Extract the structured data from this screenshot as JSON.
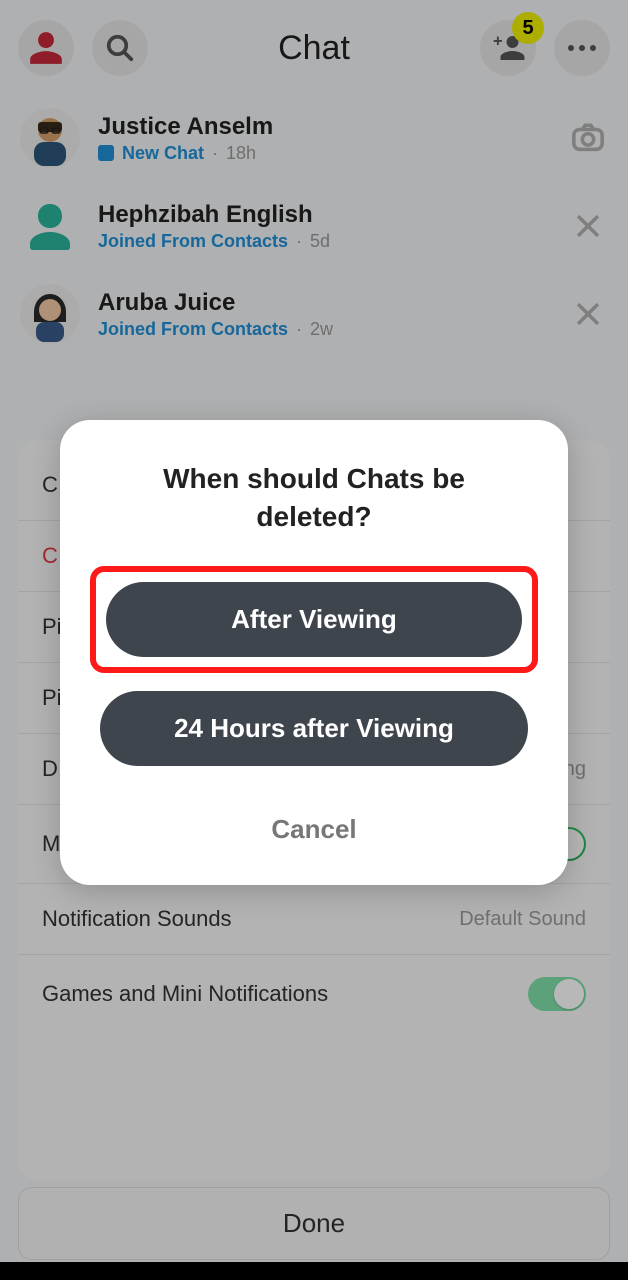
{
  "header": {
    "title": "Chat",
    "badge": "5"
  },
  "chats": [
    {
      "name": "Justice Anselm",
      "status": "New Chat",
      "time": "18h",
      "hasIcon": true,
      "action": "camera"
    },
    {
      "name": "Hephzibah English",
      "status": "Joined From Contacts",
      "time": "5d",
      "hasIcon": false,
      "action": "close"
    },
    {
      "name": "Aruba Juice",
      "status": "Joined From Contacts",
      "time": "2w",
      "hasIcon": false,
      "action": "close"
    }
  ],
  "settings": {
    "rows": [
      {
        "label": "C",
        "class": ""
      },
      {
        "label": "C",
        "class": "clear"
      },
      {
        "label": "Pi",
        "class": ""
      },
      {
        "label": "Pi",
        "class": ""
      },
      {
        "label": "D",
        "class": "",
        "value": "ng"
      },
      {
        "label": "Message Notifications",
        "class": "",
        "toggle": true
      },
      {
        "label": "Notification Sounds",
        "class": "",
        "value": "Default Sound"
      },
      {
        "label": "Games and Mini Notifications",
        "class": "",
        "toggle": true,
        "light": true
      }
    ]
  },
  "done": "Done",
  "modal": {
    "title_l1": "When should Chats be",
    "title_l2": "deleted?",
    "option1": "After Viewing",
    "option2": "24 Hours after Viewing",
    "cancel": "Cancel"
  }
}
